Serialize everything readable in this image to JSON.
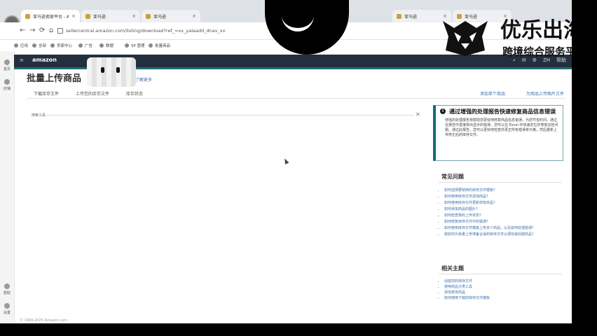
{
  "browser": {
    "tabs": [
      {
        "label": "亚马逊卖家平台 - Amazon"
      },
      {
        "label": "亚马逊"
      },
      {
        "label": "亚马逊"
      },
      {
        "label": "亚马逊"
      },
      {
        "label": "亚马逊"
      }
    ],
    "url": "sellercentral.amazon.com/listing/download?ref_=xx_yalaadd_dnav_xx",
    "nav": {
      "back": "←",
      "forward": "→",
      "reload": "⟳",
      "home": "⌂"
    },
    "bookmarks": [
      "应用",
      "全部",
      "卖家中心",
      "广告",
      "数据",
      "SP 管理",
      "批量商品"
    ]
  },
  "leftrail": {
    "items": [
      "首页",
      "店铺",
      "帮助",
      "设置"
    ]
  },
  "amazon": {
    "logo": "amazon",
    "menu_glyph": "≡",
    "header_icons": {
      "search": "⌕",
      "mail": "✉",
      "settings": "⚙",
      "language": "ZH",
      "account": "帮助"
    }
  },
  "page": {
    "title": "批量上传商品",
    "learn_more": "了解更多",
    "subtabs": [
      "下载库存文件",
      "上传您的库存文件",
      "库存状态"
    ],
    "right_links": [
      "添加单个商品",
      "为商品上传图片文件"
    ],
    "category_label": "搜索工具",
    "category_clear": "✕"
  },
  "alert": {
    "icon": "i",
    "title": "通过增强的处理报告快速修复商品信息错误",
    "body": "增强的处理报告将帮助您更快地修复商品信息错误，为您节省时间。通过在报告中直接突出显示的错误，您可以在 Excel 中快速定位并修复这些问题。通过此报告，您可以更快地检查并更正所有错误单元格，然后重新上传修正后的库存文件。"
  },
  "faq": {
    "title": "常见问题",
    "items": [
      "如何选择要使用的库存文件模板？",
      "如何使用库存文件添加商品？",
      "如何使用库存文件更新现有商品？",
      "如何添加商品的图片？",
      "如何检查我的上传状态？",
      "如何修复库存文件中的错误？",
      "如何使用库存文件模板上传多个商品，以及如何处理错误？",
      "我如何为批量上传准备合适的库存文件以便快速创建商品？"
    ]
  },
  "topics": {
    "title": "相关主题",
    "items": [
      "创建您的库存文件",
      "使用商品分类工具",
      "添加变体商品",
      "如何使用下载的库存文件模板"
    ]
  },
  "footer": {
    "note": "© 1999-2025 Amazon.com"
  },
  "overlay": {
    "brand_title": "优乐出海",
    "brand_subtitle": "跨境综合服务平"
  },
  "colors": {
    "amazon_dark": "#232f3e",
    "accent_teal": "#166b75",
    "link_blue": "#3b6fb0"
  }
}
